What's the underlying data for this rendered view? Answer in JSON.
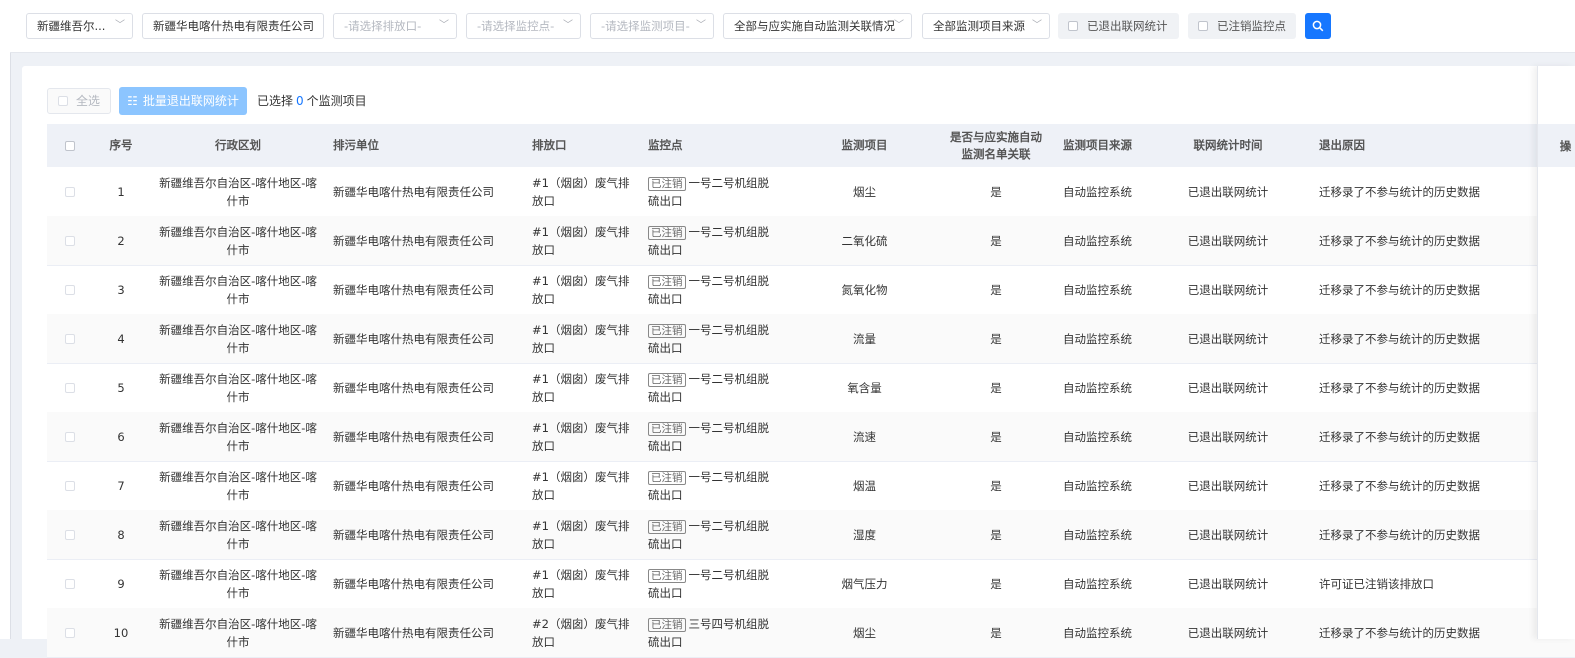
{
  "filters": {
    "region": "新疆维吾尔...",
    "company": "新疆华电喀什热电有限责任公司",
    "outlet_placeholder": "-请选择排放口-",
    "monitor_point_placeholder": "-请选择监控点-",
    "monitor_item_placeholder": "-请选择监测项目-",
    "association": "全部与应实施自动监测关联情况",
    "source": "全部监测项目来源",
    "exited_label": "已退出联网统计",
    "cancelled_label": "已注销监控点"
  },
  "toolbar": {
    "select_all": "全选",
    "batch_exit": "批量退出联网统计",
    "selected_prefix": "已选择",
    "selected_count": "0",
    "selected_suffix": "个监测项目"
  },
  "table": {
    "headers": {
      "seq": "序号",
      "region": "行政区划",
      "unit": "排污单位",
      "outlet": "排放口",
      "point": "监控点",
      "item": "监测项目",
      "assoc": "是否与应实施自动监测名单关联",
      "source": "监测项目来源",
      "stat_time": "联网统计时间",
      "reason": "退出原因",
      "extra": "操"
    },
    "rows": [
      {
        "seq": "1",
        "region": "新疆维吾尔自治区-喀什地区-喀什市",
        "unit": "新疆华电喀什热电有限责任公司",
        "outlet": "#1（烟囱）废气排放口",
        "tag": "已注销",
        "point": "一号二号机组脱硫出口",
        "item": "烟尘",
        "assoc": "是",
        "source": "自动监控系统",
        "stat": "已退出联网统计",
        "reason": "迁移录了不参与统计的历史数据"
      },
      {
        "seq": "2",
        "region": "新疆维吾尔自治区-喀什地区-喀什市",
        "unit": "新疆华电喀什热电有限责任公司",
        "outlet": "#1（烟囱）废气排放口",
        "tag": "已注销",
        "point": "一号二号机组脱硫出口",
        "item": "二氧化硫",
        "assoc": "是",
        "source": "自动监控系统",
        "stat": "已退出联网统计",
        "reason": "迁移录了不参与统计的历史数据"
      },
      {
        "seq": "3",
        "region": "新疆维吾尔自治区-喀什地区-喀什市",
        "unit": "新疆华电喀什热电有限责任公司",
        "outlet": "#1（烟囱）废气排放口",
        "tag": "已注销",
        "point": "一号二号机组脱硫出口",
        "item": "氮氧化物",
        "assoc": "是",
        "source": "自动监控系统",
        "stat": "已退出联网统计",
        "reason": "迁移录了不参与统计的历史数据"
      },
      {
        "seq": "4",
        "region": "新疆维吾尔自治区-喀什地区-喀什市",
        "unit": "新疆华电喀什热电有限责任公司",
        "outlet": "#1（烟囱）废气排放口",
        "tag": "已注销",
        "point": "一号二号机组脱硫出口",
        "item": "流量",
        "assoc": "是",
        "source": "自动监控系统",
        "stat": "已退出联网统计",
        "reason": "迁移录了不参与统计的历史数据"
      },
      {
        "seq": "5",
        "region": "新疆维吾尔自治区-喀什地区-喀什市",
        "unit": "新疆华电喀什热电有限责任公司",
        "outlet": "#1（烟囱）废气排放口",
        "tag": "已注销",
        "point": "一号二号机组脱硫出口",
        "item": "氧含量",
        "assoc": "是",
        "source": "自动监控系统",
        "stat": "已退出联网统计",
        "reason": "迁移录了不参与统计的历史数据"
      },
      {
        "seq": "6",
        "region": "新疆维吾尔自治区-喀什地区-喀什市",
        "unit": "新疆华电喀什热电有限责任公司",
        "outlet": "#1（烟囱）废气排放口",
        "tag": "已注销",
        "point": "一号二号机组脱硫出口",
        "item": "流速",
        "assoc": "是",
        "source": "自动监控系统",
        "stat": "已退出联网统计",
        "reason": "迁移录了不参与统计的历史数据"
      },
      {
        "seq": "7",
        "region": "新疆维吾尔自治区-喀什地区-喀什市",
        "unit": "新疆华电喀什热电有限责任公司",
        "outlet": "#1（烟囱）废气排放口",
        "tag": "已注销",
        "point": "一号二号机组脱硫出口",
        "item": "烟温",
        "assoc": "是",
        "source": "自动监控系统",
        "stat": "已退出联网统计",
        "reason": "迁移录了不参与统计的历史数据"
      },
      {
        "seq": "8",
        "region": "新疆维吾尔自治区-喀什地区-喀什市",
        "unit": "新疆华电喀什热电有限责任公司",
        "outlet": "#1（烟囱）废气排放口",
        "tag": "已注销",
        "point": "一号二号机组脱硫出口",
        "item": "湿度",
        "assoc": "是",
        "source": "自动监控系统",
        "stat": "已退出联网统计",
        "reason": "迁移录了不参与统计的历史数据"
      },
      {
        "seq": "9",
        "region": "新疆维吾尔自治区-喀什地区-喀什市",
        "unit": "新疆华电喀什热电有限责任公司",
        "outlet": "#1（烟囱）废气排放口",
        "tag": "已注销",
        "point": "一号二号机组脱硫出口",
        "item": "烟气压力",
        "assoc": "是",
        "source": "自动监控系统",
        "stat": "已退出联网统计",
        "reason": "许可证已注销该排放口"
      },
      {
        "seq": "10",
        "region": "新疆维吾尔自治区-喀什地区-喀什市",
        "unit": "新疆华电喀什热电有限责任公司",
        "outlet": "#2（烟囱）废气排放口",
        "tag": "已注销",
        "point": "三号四号机组脱硫出口",
        "item": "烟尘",
        "assoc": "是",
        "source": "自动监控系统",
        "stat": "已退出联网统计",
        "reason": "迁移录了不参与统计的历史数据"
      }
    ]
  }
}
